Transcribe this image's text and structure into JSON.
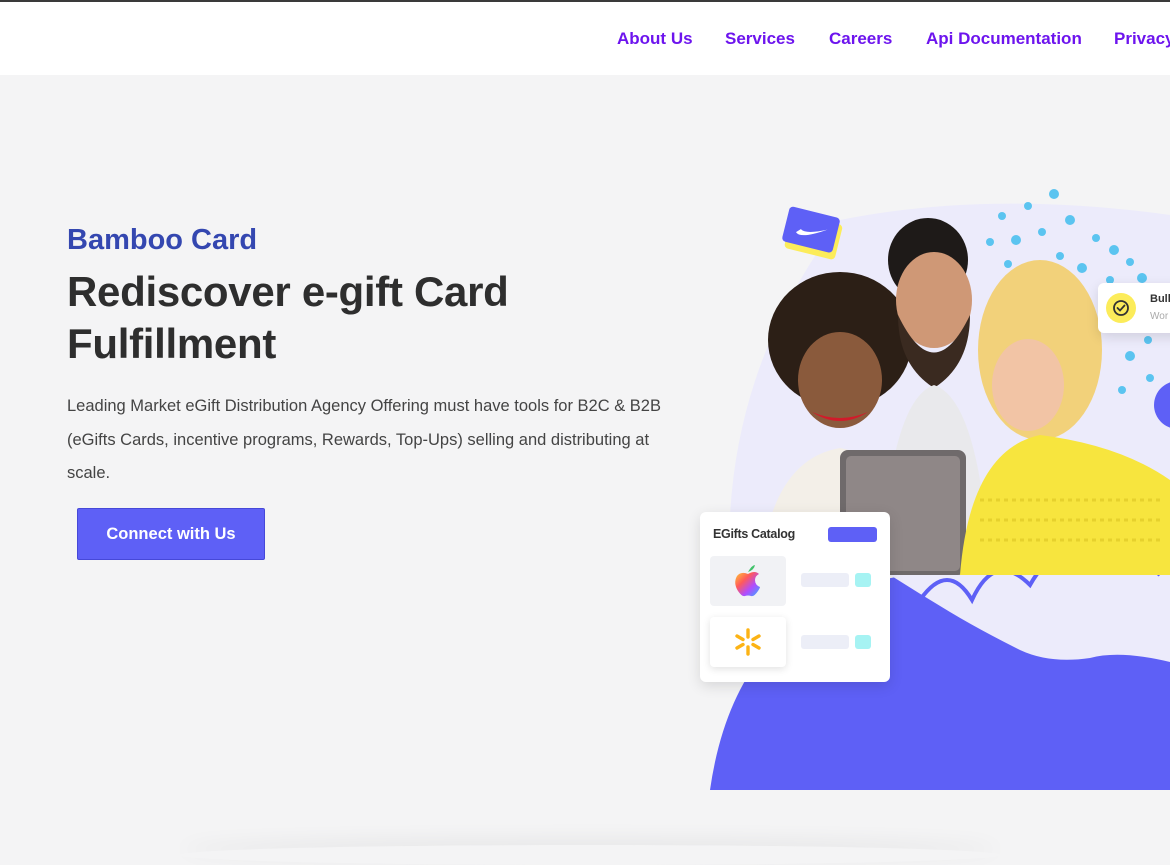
{
  "nav": {
    "links": [
      {
        "label": "About Us"
      },
      {
        "label": "Services"
      },
      {
        "label": "Careers"
      },
      {
        "label": "Api Documentation"
      },
      {
        "label": "Privacy"
      }
    ]
  },
  "hero": {
    "brand": "Bamboo Card",
    "headline": "Rediscover e-gift Card Fulfillment",
    "description": "Leading Market eGift Distribution Agency Offering must have tools for B2C & B2B (eGifts Cards, incentive programs, Rewards, Top-Ups) selling and distributing at scale.",
    "cta_label": "Connect with Us"
  },
  "illustration": {
    "catalog_title": "EGifts Catalog",
    "catalog_items": [
      "apple-logo-icon",
      "walmart-spark-icon"
    ],
    "notification_title": "Bull",
    "notification_sub": "Wor"
  },
  "colors": {
    "accent": "#5e60f6",
    "nav_link": "#6d14ee",
    "brand": "#3447b0",
    "background": "#f4f4f5"
  }
}
